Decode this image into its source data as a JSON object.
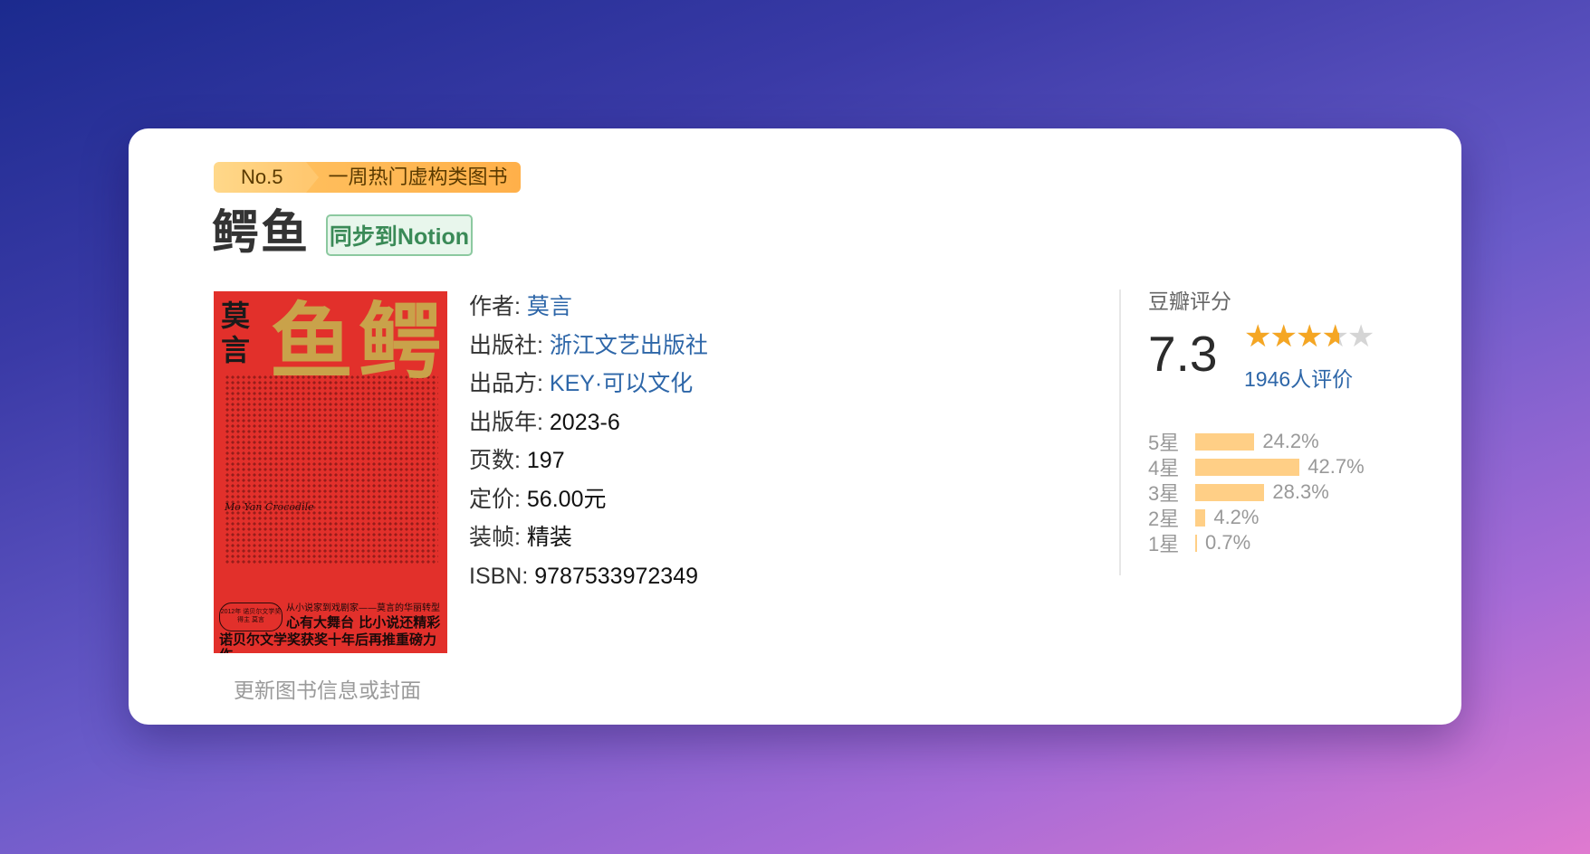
{
  "badge": {
    "rank": "No.5",
    "label": "一周热门虚构类图书"
  },
  "title": "鳄鱼",
  "notion_button": "同步到Notion",
  "cover": {
    "author": "莫言",
    "title": "鳄鱼",
    "english": "Mo Yan Crocodile",
    "tag": "2012年 诺贝尔文学奖得主 莫言",
    "line1": "从小说家到戏剧家——莫言的华丽转型",
    "line2": "心有大舞台 比小说还精彩",
    "line3": "诺贝尔文学奖获奖十年后再推重磅力作"
  },
  "update_link": "更新图书信息或封面",
  "info": {
    "author_label": "作者:",
    "author": "莫言",
    "publisher_label": "出版社:",
    "publisher": "浙江文艺出版社",
    "producer_label": "出品方:",
    "producer": "KEY·可以文化",
    "year_label": "出版年:",
    "year": "2023-6",
    "pages_label": "页数:",
    "pages": "197",
    "price_label": "定价:",
    "price": "56.00元",
    "binding_label": "装帧:",
    "binding": "精装",
    "isbn_label": "ISBN:",
    "isbn": "9787533972349"
  },
  "rating": {
    "label": "豆瓣评分",
    "score": "7.3",
    "stars": 3.5,
    "count": "1946人评价",
    "distribution": [
      {
        "label": "5星",
        "pct": "24.2%",
        "value": 24.2
      },
      {
        "label": "4星",
        "pct": "42.7%",
        "value": 42.7
      },
      {
        "label": "3星",
        "pct": "28.3%",
        "value": 28.3
      },
      {
        "label": "2星",
        "pct": "4.2%",
        "value": 4.2
      },
      {
        "label": "1星",
        "pct": "0.7%",
        "value": 0.7
      }
    ]
  },
  "colors": {
    "accent_link": "#2d66a8",
    "bar": "#ffcf86",
    "star": "#f5a623",
    "notion_green": "#3a8a57"
  }
}
